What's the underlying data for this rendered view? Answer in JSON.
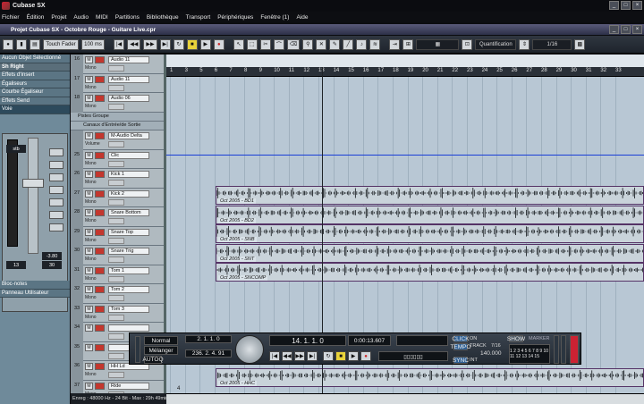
{
  "window": {
    "app_title": "Cubase SX",
    "project_title": "Projet Cubase SX - Octobre Rouge - Guitare Live.cpr"
  },
  "menu": [
    "Fichier",
    "Édition",
    "Projet",
    "Audio",
    "MIDI",
    "Partitions",
    "Bibliothèque",
    "Transport",
    "Périphériques",
    "Fenêtre (1)",
    "Aide"
  ],
  "toolbar": {
    "automation_mode": "Touch Fader",
    "time_value": "100 ms",
    "quantize_label": "Quantification",
    "quantize_value": "1/16"
  },
  "inspector": {
    "selected_track": "Sh Right",
    "sections_top": [
      "Aucun Objet Sélectionné",
      "Sh Right",
      "Effets d'Insert",
      "Égaliseurs",
      "Courbe Égaliseur",
      "Effets Send",
      "Voie"
    ],
    "channel": {
      "label": "stb",
      "readout1": "-3.80",
      "readout2": "30",
      "readout3": "13"
    },
    "sections_bottom": [
      "Bloc-notes",
      "Panneau Utilisateur"
    ]
  },
  "tracks": [
    {
      "num": "16",
      "name": "Audio 11",
      "sub": "Mono"
    },
    {
      "num": "17",
      "name": "Audio 11",
      "sub": "Mono"
    },
    {
      "num": "18",
      "name": "Audio 06",
      "sub": "Mono"
    },
    {
      "num": "",
      "name": "Pistes Groupe",
      "sub": ""
    },
    {
      "num": "",
      "name": "Canaux d'Entrée/de Sortie",
      "sub": ""
    },
    {
      "num": "",
      "name": "M-Audio Delta",
      "sub": "Volume"
    },
    {
      "num": "25",
      "name": "Clic",
      "sub": "Mono"
    },
    {
      "num": "26",
      "name": "Kick 1",
      "sub": "Mono"
    },
    {
      "num": "27",
      "name": "Kick 2",
      "sub": "Mono"
    },
    {
      "num": "28",
      "name": "Snare Bottom",
      "sub": "Mono"
    },
    {
      "num": "29",
      "name": "Snare Top",
      "sub": "Mono"
    },
    {
      "num": "30",
      "name": "Snare Trig",
      "sub": "Mono"
    },
    {
      "num": "31",
      "name": "Tom 1",
      "sub": "Mono"
    },
    {
      "num": "32",
      "name": "Tom 2",
      "sub": "Mono"
    },
    {
      "num": "33",
      "name": "Tom 3",
      "sub": "Mono"
    },
    {
      "num": "34",
      "name": "",
      "sub": ""
    },
    {
      "num": "35",
      "name": "",
      "sub": ""
    },
    {
      "num": "36",
      "name": "HH Ld",
      "sub": "Mono"
    },
    {
      "num": "37",
      "name": "Ride",
      "sub": "Mono"
    }
  ],
  "ruler": {
    "labels": [
      "1",
      "3",
      "5",
      "6",
      "7",
      "8",
      "9",
      "10",
      "11",
      "12",
      "13",
      "14",
      "15",
      "16",
      "17",
      "18",
      "19",
      "20",
      "21",
      "22",
      "23",
      "24",
      "25",
      "26",
      "27",
      "28",
      "29",
      "30",
      "31",
      "32",
      "33"
    ],
    "bottom_label": "4"
  },
  "parts": [
    {
      "label": "Oct 2005 - BD1"
    },
    {
      "label": "Oct 2005 - BD2"
    },
    {
      "label": "Oct 2005 - SNB"
    },
    {
      "label": "Oct 2005 - SNT"
    },
    {
      "label": "Oct 2005 - SNCOMP"
    },
    {
      "label": "Oct 2005 - HHC"
    }
  ],
  "transport": {
    "mode1": "Normal",
    "mode2": "Mélanger",
    "autoq": "AUTOQ",
    "left_locator": "2. 1. 1. 0",
    "right_locator": "236. 2. 4. 91",
    "position_bars": "14. 1. 1. 0",
    "position_time": "0:00:13.607",
    "click": "CLICK",
    "click_state": "ON",
    "tempo_label": "TEMPO",
    "tempo_mode": "TRACK",
    "signature": "7/16",
    "tempo_value": "140.000",
    "sync_label": "SYNC",
    "sync_state": "INT",
    "show_label": "SHOW",
    "marker_label": "MARKER"
  },
  "status": {
    "text": "Enreg : 48000 Hz - 24 Bit - Max : 29h 49min"
  }
}
